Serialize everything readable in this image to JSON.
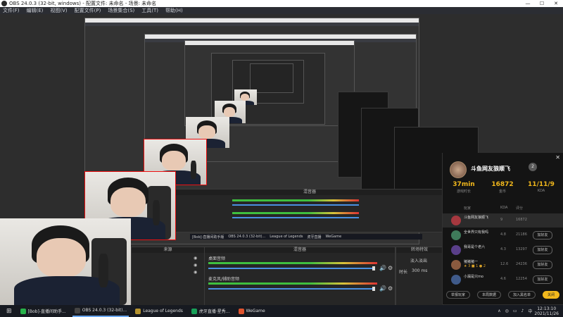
{
  "window": {
    "title": "OBS 24.0.3 (32-bit, windows) - 配置文件: 未命名 - 场景: 未命名",
    "controls": [
      "—",
      "☐",
      "✕"
    ]
  },
  "menu": [
    "文件(F)",
    "编辑(E)",
    "视图(V)",
    "配置文件(P)",
    "场景集合(S)",
    "工具(T)",
    "帮助(H)"
  ],
  "obs_docks": {
    "sources_header": "来源",
    "mixer_header": "混音器",
    "transitions_header": "转场特效",
    "mixer_tracks": [
      {
        "label": "桌面音频"
      },
      {
        "label": "麦克风/辅助音频"
      }
    ],
    "transition_value": "淡入淡出",
    "duration_label": "时长",
    "duration_value": "300 ms"
  },
  "inner_taskbar": [
    "[Bob]-直播间助手版",
    "OBS 24.0.3 (32-bit)...",
    "League of Legends",
    "虎牙直播",
    "WeGame"
  ],
  "popup": {
    "close": "✕",
    "name": "斗鱼网友狼顺飞",
    "badge": "2",
    "stats": [
      {
        "value": "37min",
        "label": "游戏时长"
      },
      {
        "value": "16872",
        "label": "金币"
      },
      {
        "value": "11/11/9",
        "label": "KDA"
      }
    ],
    "columns": [
      "玩家",
      "KDA",
      "评分"
    ],
    "players": [
      {
        "name": "斗鱼网友狼顺飞",
        "sub": "",
        "kda": "9",
        "score": "16872",
        "button": "",
        "color": "#a6383f",
        "highlight": true
      },
      {
        "name": "全世界只有我吗",
        "sub": "",
        "kda": "4.8",
        "score": "21186",
        "button": "加好友",
        "color": "#3f7a5a",
        "highlight": false
      },
      {
        "name": "我哥是个老六",
        "sub": "",
        "kda": "4.3",
        "score": "13297",
        "button": "加好友",
        "color": "#5a3f8a",
        "highlight": false
      },
      {
        "name": "猪猪猪一",
        "sub": "★ 3 ■ 1 ● 2",
        "kda": "12.6",
        "score": "24236",
        "button": "加好友",
        "color": "#8a5a3f",
        "highlight": false
      },
      {
        "name": "小漏是只mo",
        "sub": "",
        "kda": "4.6",
        "score": "12254",
        "button": "加好友",
        "color": "#3f5a8a",
        "highlight": false
      }
    ],
    "footer": {
      "report": "举报玩家",
      "stats": "本局数据",
      "blacklist": "加入黑名单",
      "primary": "关闭"
    }
  },
  "taskbar": {
    "start": "⊞",
    "apps": [
      {
        "label": "[Bob]-直播间助手...",
        "color": "#27b24a"
      },
      {
        "label": "OBS 24.0.3 (32-bit)...",
        "color": "#444444"
      },
      {
        "label": "League of Legends",
        "color": "#b5932f"
      },
      {
        "label": "虎牙直播·星秀...",
        "color": "#18a058"
      },
      {
        "label": "WeGame",
        "color": "#e0542e"
      }
    ],
    "tray_icons": [
      "∧",
      "◎",
      "▭",
      "♪",
      "中"
    ],
    "time": "12:13:10",
    "date": "2021/11/26"
  },
  "colors": {
    "accent": "#f2b81c",
    "cam_border": "#e11111"
  }
}
